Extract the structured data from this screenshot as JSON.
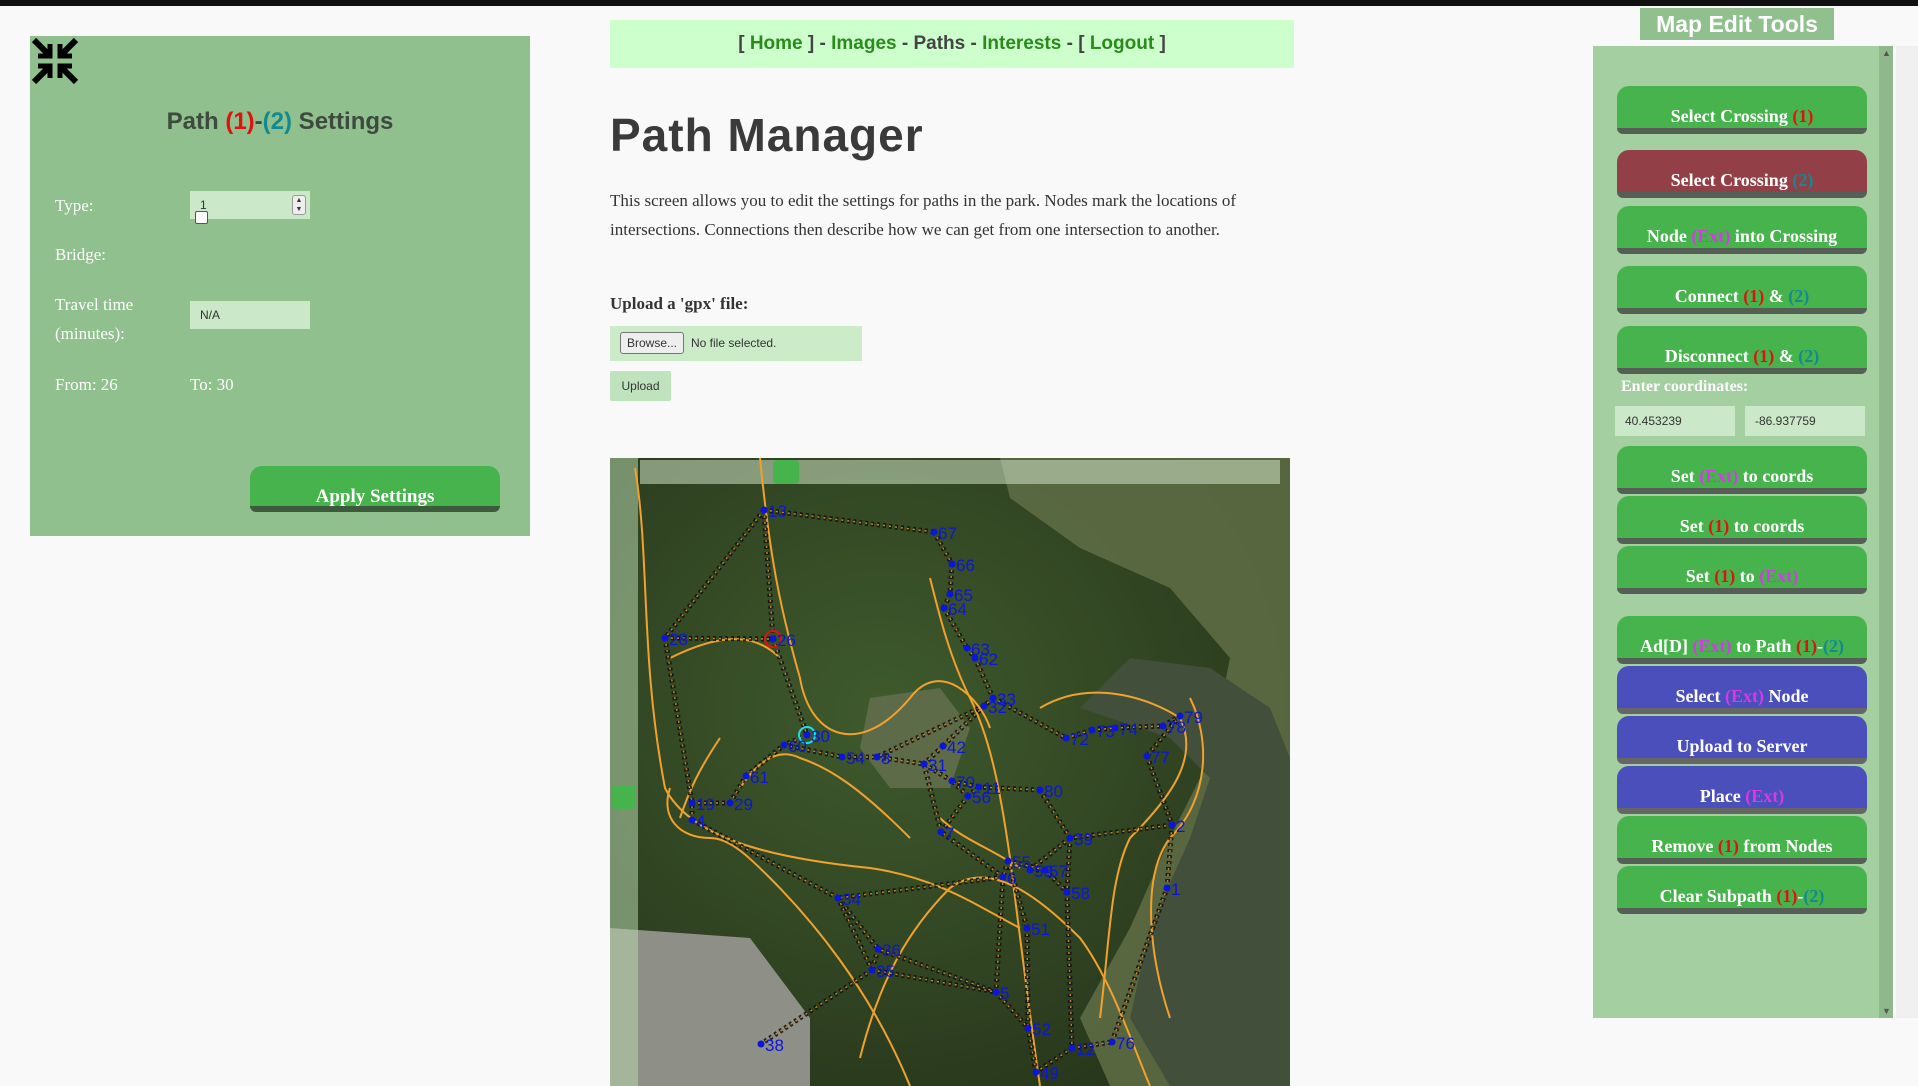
{
  "settings": {
    "title_prefix": "Path ",
    "title_one": "(1)",
    "title_dash": "-",
    "title_two": "(2)",
    "title_suffix": " Settings",
    "type_label": "Type:",
    "type_value": "1",
    "bridge_label": "Bridge:",
    "bridge_checked": false,
    "travel_label_1": "Travel time",
    "travel_label_2": "(minutes):",
    "travel_value": "N/A",
    "from": "From: 26",
    "to": "To: 30",
    "apply": "Apply Settings"
  },
  "nav": {
    "lbracket": "[ ",
    "home": "Home",
    "sep1": " ] - ",
    "images": "Images",
    "sep2": " - ",
    "paths": "Paths",
    "sep3": " - ",
    "interests": "Interests",
    "sep4": " - [ ",
    "logout": "Logout",
    "rbracket": " ]"
  },
  "main": {
    "title": "Path Manager",
    "description": "This screen allows you to edit the settings for paths in the park. Nodes mark the locations of intersections. Connections then describe how we can get from one intersection to another.",
    "upload_label": "Upload a 'gpx' file:",
    "browse": "Browse...",
    "file_status": "No file selected.",
    "upload_button": "Upload"
  },
  "map": {
    "nodes": [
      {
        "id": "13"
      },
      {
        "id": "67"
      },
      {
        "id": "66"
      },
      {
        "id": "65"
      },
      {
        "id": "64"
      },
      {
        "id": "28"
      },
      {
        "id": "26"
      },
      {
        "id": "63"
      },
      {
        "id": "62"
      },
      {
        "id": "33"
      },
      {
        "id": "32"
      },
      {
        "id": "79"
      },
      {
        "id": "78"
      },
      {
        "id": "74"
      },
      {
        "id": "73"
      },
      {
        "id": "72"
      },
      {
        "id": "42"
      },
      {
        "id": "30"
      },
      {
        "id": "60"
      },
      {
        "id": "54"
      },
      {
        "id": "8"
      },
      {
        "id": "31"
      },
      {
        "id": "77"
      },
      {
        "id": "61"
      },
      {
        "id": "70"
      },
      {
        "id": "11"
      },
      {
        "id": "56"
      },
      {
        "id": "80"
      },
      {
        "id": "29"
      },
      {
        "id": "19"
      },
      {
        "id": "2"
      },
      {
        "id": "4"
      },
      {
        "id": "7"
      },
      {
        "id": "39"
      },
      {
        "id": "55"
      },
      {
        "id": "59"
      },
      {
        "id": "57"
      },
      {
        "id": "6"
      },
      {
        "id": "58"
      },
      {
        "id": "1"
      },
      {
        "id": "34"
      },
      {
        "id": "51"
      },
      {
        "id": "36"
      },
      {
        "id": "35"
      },
      {
        "id": "5"
      },
      {
        "id": "52"
      },
      {
        "id": "12"
      },
      {
        "id": "76"
      },
      {
        "id": "38"
      },
      {
        "id": "49"
      }
    ],
    "selected_one": "26",
    "selected_two": "30"
  },
  "tools": {
    "title": "Map Edit Tools",
    "select1_text": "Select Crossing ",
    "select1_tag": "(1)",
    "select2_text": "Select Crossing ",
    "select2_tag": "(2)",
    "node_ext_a": "Node ",
    "node_ext_tag": "(Ext)",
    "node_ext_b": " into Crossing",
    "connect_a": "Connect ",
    "connect_one": "(1)",
    "connect_amp": " & ",
    "connect_two": "(2)",
    "disconnect_a": "Disconnect ",
    "disconnect_one": "(1)",
    "disconnect_amp": " & ",
    "disconnect_two": "(2)",
    "coord_label": "Enter coordinates:",
    "lat": "40.453239",
    "lon": "-86.937759",
    "setext_a": "Set ",
    "setext_tag": "(Ext)",
    "setext_b": " to coords",
    "set1_a": "Set ",
    "set1_tag": "(1)",
    "set1_b": " to coords",
    "set1ext_a": "Set ",
    "set1ext_one": "(1)",
    "set1ext_b": " to ",
    "set1ext_tag": "(Ext)",
    "add_a": "Ad[D] ",
    "add_ext": "(Ext)",
    "add_b": " to Path ",
    "add_one": "(1)",
    "add_dash": "-",
    "add_two": "(2)",
    "selext_a": "Select ",
    "selext_tag": "(Ext)",
    "selext_b": " Node",
    "upload_server": "Upload to Server",
    "place_a": "Place ",
    "place_tag": "(Ext)",
    "remove_a": "Remove ",
    "remove_tag": "(1)",
    "remove_b": " from Nodes",
    "clear_a": "Clear Subpath ",
    "clear_one": "(1)",
    "clear_dash": "-",
    "clear_two": "(2)"
  },
  "colors": {
    "panel_green": "#8fc08d",
    "button_green": "#47b34c",
    "button_maroon": "#933f47",
    "button_blue": "#4b4fbb",
    "tag_red": "#e0120f",
    "tag_teal": "#128a8f",
    "tag_magenta": "#d43be6",
    "nav_bg": "#ccffcc",
    "nav_link": "#2a8a1c",
    "node_blue": "#0b16d8",
    "trail_orange": "#f0a12e"
  }
}
